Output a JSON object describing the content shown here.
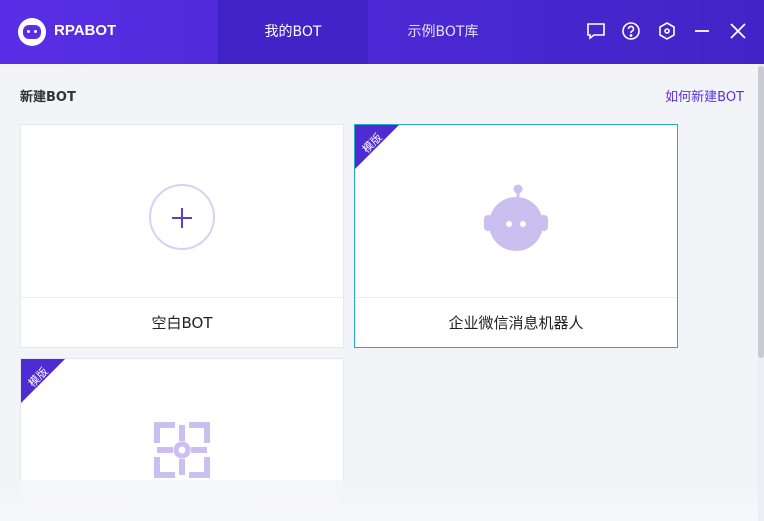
{
  "app": {
    "title": "RPABOT"
  },
  "nav": {
    "tabs": [
      {
        "label": "我的BOT"
      },
      {
        "label": "示例BOT库"
      }
    ]
  },
  "window_icons": [
    "message-icon",
    "help-icon",
    "settings-hex-icon",
    "minimize-icon",
    "close-icon"
  ],
  "section": {
    "title": "新建BOT",
    "howto_link": "如何新建BOT"
  },
  "cards": [
    {
      "label": "空白BOT",
      "badge": "",
      "icon": "plus-circle-icon"
    },
    {
      "label": "企业微信消息机器人",
      "badge": "模版",
      "icon": "robot-head-icon"
    },
    {
      "label": "",
      "badge": "模版",
      "icon": "frame-grid-icon"
    }
  ],
  "colors": {
    "brand": "#5a2ee6",
    "icon_tint": "#c9c0f0",
    "selected_border": "#27a9c6"
  }
}
